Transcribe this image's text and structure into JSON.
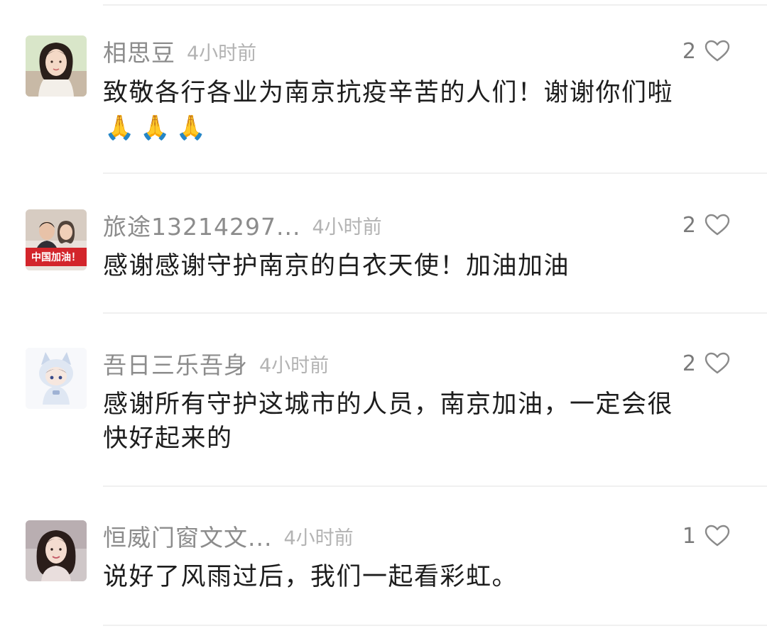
{
  "comments": [
    {
      "username": "相思豆",
      "time": "4小时前",
      "likes": "2",
      "text": "致敬各行各业为南京抗疫辛苦的人们！谢谢你们啦",
      "emojis": [
        "🙏",
        "🙏",
        "🙏"
      ],
      "avatar_icon": "woman-portrait-icon"
    },
    {
      "username": "旅途13214297...",
      "time": "4小时前",
      "likes": "2",
      "text": "感谢感谢守护南京的白衣天使！加油加油",
      "avatar_badge": "中国加油！",
      "avatar_icon": "couple-photo-icon"
    },
    {
      "username": "吾日三乐吾身",
      "time": "4小时前",
      "likes": "2",
      "text_line1": "感谢所有守护这城市的人员，南京加油，一定会很",
      "text_line2": "快好起来的",
      "avatar_icon": "anime-cat-hood-icon"
    },
    {
      "username": "恒威门窗文文...",
      "time": "4小时前",
      "likes": "1",
      "text": "说好了风雨过后，我们一起看彩虹。",
      "avatar_icon": "woman-portrait-icon"
    }
  ],
  "colors": {
    "username": "#8c8c8c",
    "time": "#b3b3b3",
    "text": "#1d1d1d",
    "divider": "#f0f0f0",
    "badge": "#d3252b"
  }
}
